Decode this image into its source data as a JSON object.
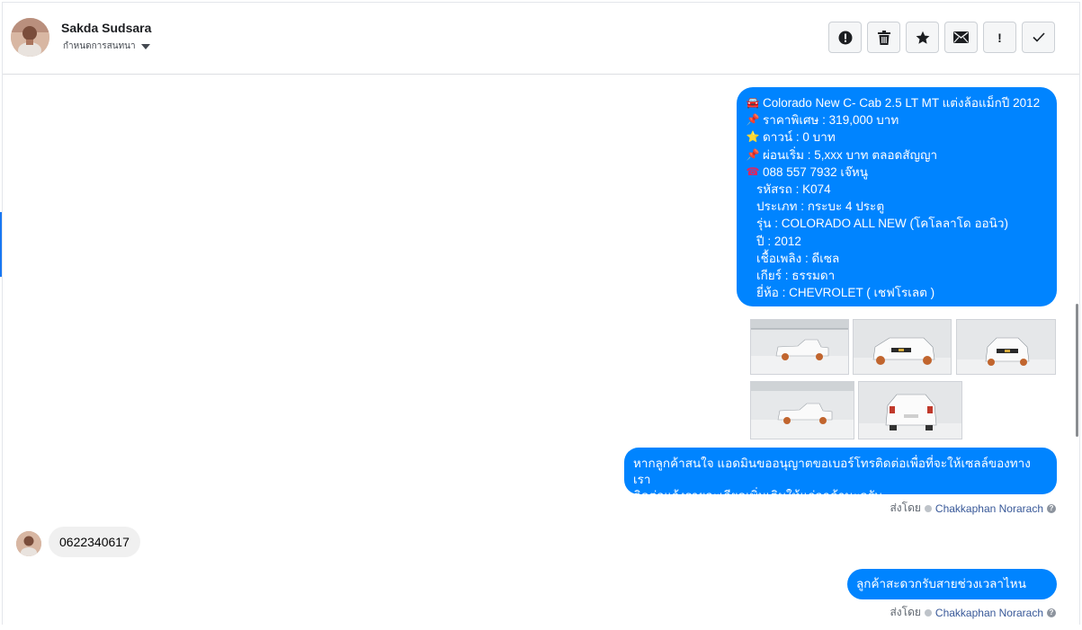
{
  "header": {
    "contact_name": "Sakda Sudsara",
    "status_label": "กำหนดการสนทนา",
    "actions": [
      {
        "name": "alert-circle-icon",
        "tooltip": ""
      },
      {
        "name": "trash-icon",
        "tooltip": ""
      },
      {
        "name": "star-icon",
        "tooltip": ""
      },
      {
        "name": "envelope-icon",
        "tooltip": ""
      },
      {
        "name": "exclamation-icon",
        "label": "!"
      },
      {
        "name": "checkmark-icon",
        "tooltip": ""
      }
    ]
  },
  "messages": {
    "car_listing": {
      "lines": [
        {
          "icon": "car-emoji",
          "text": "Colorado New C- Cab 2.5 LT MT แต่งล้อแม็กปี 2012"
        },
        {
          "icon": "pushpin-emoji",
          "text": "ราคาพิเศษ : 319,000 บาท"
        },
        {
          "icon": "star-emoji",
          "text": "ดาวน์ : 0 บาท"
        },
        {
          "icon": "pushpin-emoji",
          "text": "ผ่อนเริ่ม : 5,xxx บาท ตลอดสัญญา"
        },
        {
          "icon": "telephone-emoji",
          "text": "088 557 7932 เจ๊หนู"
        },
        {
          "icon": "",
          "text": "รหัสรถ : K074"
        },
        {
          "icon": "",
          "text": "ประเภท : กระบะ 4 ประตู"
        },
        {
          "icon": "",
          "text": "รุ่น : COLORADO ALL NEW (โคโลลาโด ออนิว)"
        },
        {
          "icon": "",
          "text": "ปี : 2012"
        },
        {
          "icon": "",
          "text": "เชื้อเพลิง : ดีเซล"
        },
        {
          "icon": "",
          "text": "เกียร์ : ธรรมดา"
        },
        {
          "icon": "",
          "text": "ยี่ห้อ : CHEVROLET ( เชฟโรเลต )"
        }
      ],
      "photos": [
        "car-side-photo",
        "car-front-three-quarter-photo",
        "car-front-photo",
        "car-side-rear-photo",
        "car-rear-photo"
      ]
    },
    "agent_followup": {
      "line1": "หากลูกค้าสนใจ แอดมินขออนุญาตขอเบอร์โทรติดต่อเพื่อที่จะให้เซลล์ของทางเรา",
      "line2": "ติดต่อแจ้งรายละเอียดเพิ่มเติมให้แก่ลูกค้านะครับ"
    },
    "sent_by_label": "ส่งโดย",
    "agent_name": "Chakkaphan Norarach",
    "customer_reply": "0622340617",
    "agent_question": "ลูกค้าสะดวกรับสายช่วงเวลาไหนครับ"
  },
  "colors": {
    "outgoing_bubble": "#0084ff",
    "incoming_bubble": "#f0f0f0",
    "agent_link": "#385898"
  }
}
